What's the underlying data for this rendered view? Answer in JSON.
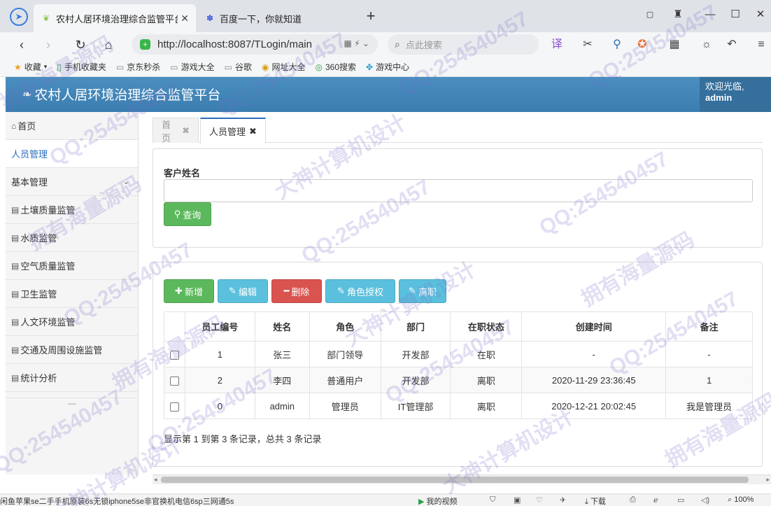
{
  "browser": {
    "tabs": [
      {
        "label": "农村人居环境治理综合监管平台",
        "active": true
      },
      {
        "label": "百度一下，你就知道",
        "active": false
      }
    ],
    "url": "http://localhost:8087/TLogin/main",
    "search_placeholder": "点此搜索",
    "bookmarks": [
      "收藏",
      "手机收藏夹",
      "京东秒杀",
      "游戏大全",
      "谷歌",
      "网址大全",
      "360搜索",
      "游戏中心"
    ]
  },
  "app": {
    "title": "农村人居环境治理综合监管平台",
    "welcome_line1": "欢迎光临,",
    "welcome_line2": "admin"
  },
  "sidebar": {
    "items": [
      {
        "label": "首页"
      },
      {
        "label": "人员管理"
      },
      {
        "label": "基本管理"
      },
      {
        "label": "土壤质量监管"
      },
      {
        "label": "水质监管"
      },
      {
        "label": "空气质量监管"
      },
      {
        "label": "卫生监管"
      },
      {
        "label": "人文环境监管"
      },
      {
        "label": "交通及周围设施监管"
      },
      {
        "label": "统计分析"
      }
    ]
  },
  "content_tabs": {
    "home": "首页",
    "current": "人员管理"
  },
  "query": {
    "label": "客户姓名",
    "input_value": "",
    "button": "查询"
  },
  "toolbar": {
    "add": "新增",
    "edit": "编辑",
    "delete": "删除",
    "role_auth": "角色授权",
    "resign": "离职"
  },
  "table": {
    "columns": [
      "员工编号",
      "姓名",
      "角色",
      "部门",
      "在职状态",
      "创建时间",
      "备注"
    ],
    "rows": [
      {
        "id": "1",
        "name": "张三",
        "role": "部门领导",
        "dept": "开发部",
        "status": "在职",
        "created": "-",
        "note": "-"
      },
      {
        "id": "2",
        "name": "李四",
        "role": "普通用户",
        "dept": "开发部",
        "status": "离职",
        "created": "2020-11-29 23:36:45",
        "note": "1"
      },
      {
        "id": "0",
        "name": "admin",
        "role": "管理员",
        "dept": "IT管理部",
        "status": "离职",
        "created": "2020-12-21 20:02:45",
        "note": "我是管理员"
      }
    ]
  },
  "pager": "显示第 1 到第 3 条记录，总共 3 条记录",
  "statusbar": {
    "left": "闲鱼苹果se二手手机原装6s无锁iphone5se非官换机电信6sp三网通5s",
    "video": "我的视频",
    "download": "下载",
    "zoom": "100%"
  },
  "watermarks": {
    "qq": "QQ:254540457",
    "own": "拥有海量源码",
    "design": "大神计算机设计"
  }
}
